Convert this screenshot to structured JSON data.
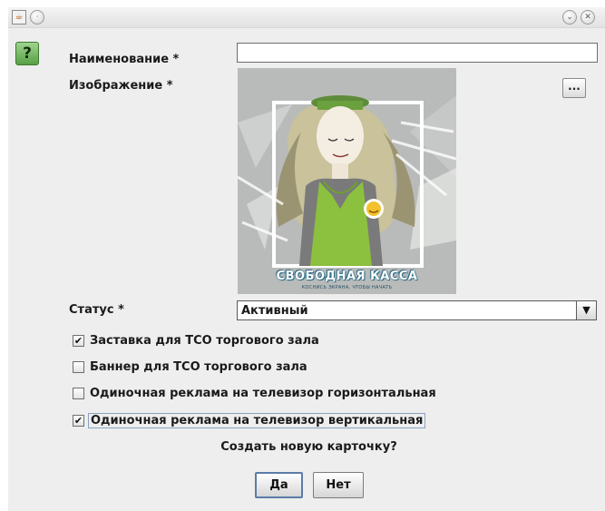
{
  "titlebar": {
    "app_icon": "java-cup-icon",
    "left_buttons": [
      "minimize-icon"
    ],
    "right_buttons": [
      "chevron-down-icon",
      "close-icon"
    ]
  },
  "form": {
    "help_icon_glyph": "?",
    "name_label": "Наименование *",
    "name_value": "",
    "image_label": "Изображение *",
    "browse_label": "...",
    "preview": {
      "title": "СВОБОДНАЯ КАССА",
      "subtitle": "КОСНИСЬ ЭКРАНА, ЧТОБЫ НАЧАТЬ"
    },
    "status_label": "Статус *",
    "status_value": "Активный",
    "checkboxes": [
      {
        "label": "Заставка для ТСО торгового зала",
        "checked": true,
        "mark": "✔"
      },
      {
        "label": "Баннер для ТСО торгового зала",
        "checked": false,
        "mark": ""
      },
      {
        "label": "Одиночная реклама на телевизор горизонтальная",
        "checked": false,
        "mark": ""
      },
      {
        "label": "Одиночная реклама на телевизор вертикальная",
        "checked": true,
        "mark": "✔"
      }
    ]
  },
  "dialog": {
    "question": "Создать новую карточку?",
    "yes_label": "Да",
    "no_label": "Нет"
  }
}
